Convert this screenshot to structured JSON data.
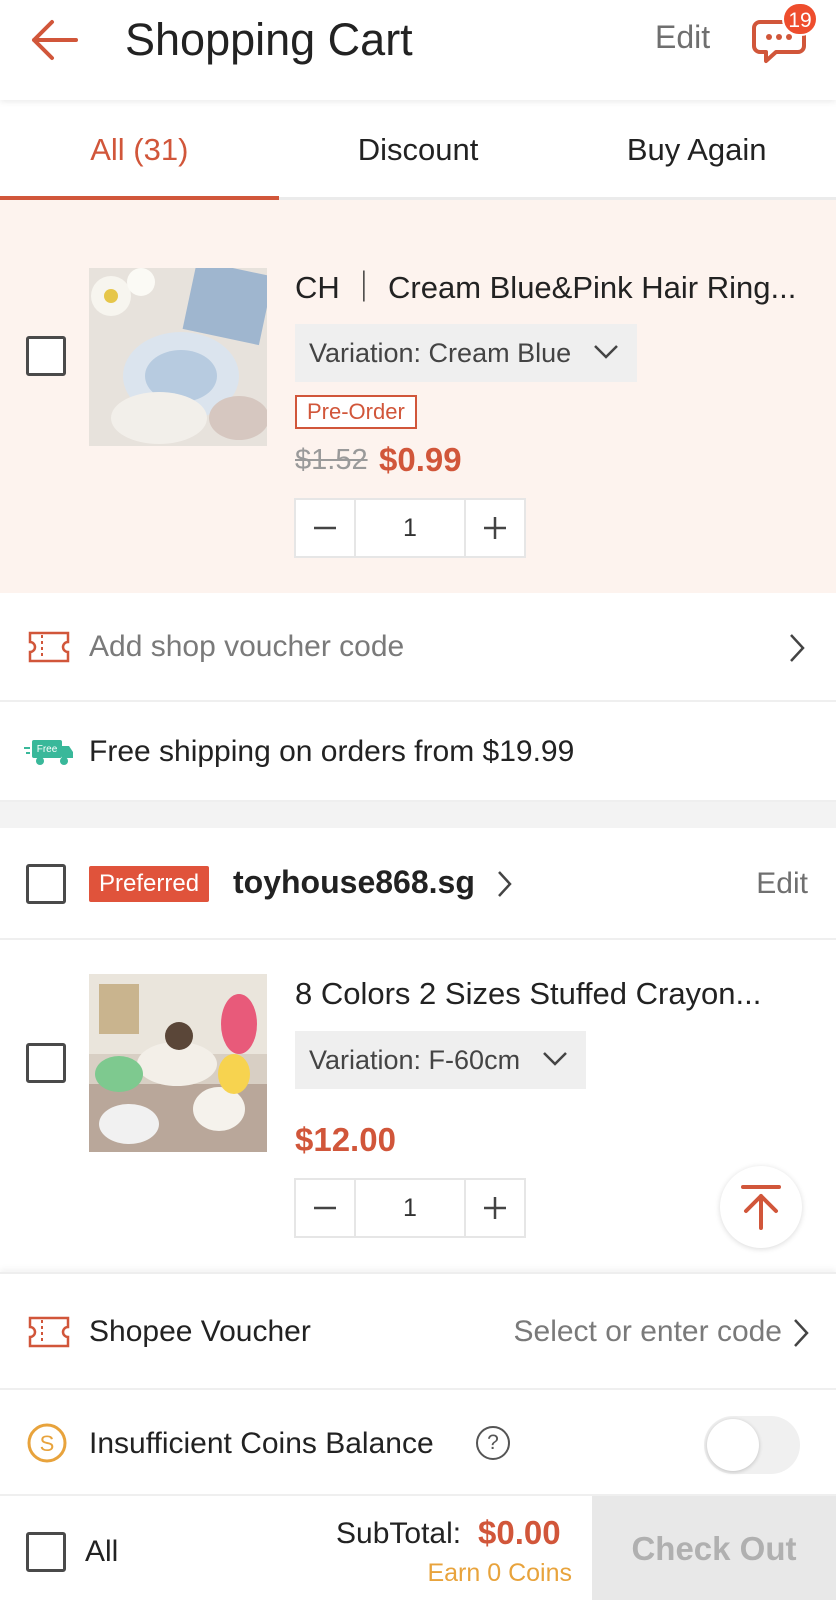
{
  "header": {
    "title": "Shopping Cart",
    "edit_label": "Edit",
    "chat_badge": "19"
  },
  "tabs": [
    {
      "label": "All (31)",
      "active": true
    },
    {
      "label": "Discount",
      "active": false
    },
    {
      "label": "Buy Again",
      "active": false
    }
  ],
  "items": [
    {
      "name": "CH ｜ Cream Blue&Pink Hair Ring...",
      "variation": "Variation: Cream Blue",
      "tag": "Pre-Order",
      "old_price": "$1.52",
      "price": "$0.99",
      "quantity": "1"
    },
    {
      "name": "8 Colors 2 Sizes Stuffed Crayon...",
      "variation": "Variation: F-60cm",
      "price": "$12.00",
      "quantity": "1"
    }
  ],
  "shop_voucher": {
    "label": "Add shop voucher code"
  },
  "shipping": {
    "free_badge": "Free",
    "text": "Free shipping on orders from $19.99"
  },
  "shop": {
    "badge": "Preferred",
    "name": "toyhouse868.sg",
    "edit_label": "Edit"
  },
  "shopee_voucher": {
    "label": "Shopee Voucher",
    "action": "Select or enter code"
  },
  "coins": {
    "label": "Insufficient Coins Balance",
    "help": "?",
    "toggle_on": false
  },
  "checkout": {
    "all_label": "All",
    "subtotal_label": "SubTotal:",
    "subtotal_value": "$0.00",
    "earn_coins": "Earn 0 Coins",
    "button_label": "Check Out"
  },
  "colors": {
    "accent": "#d1563a",
    "coin": "#e8a33c",
    "free_green": "#39b89a"
  }
}
